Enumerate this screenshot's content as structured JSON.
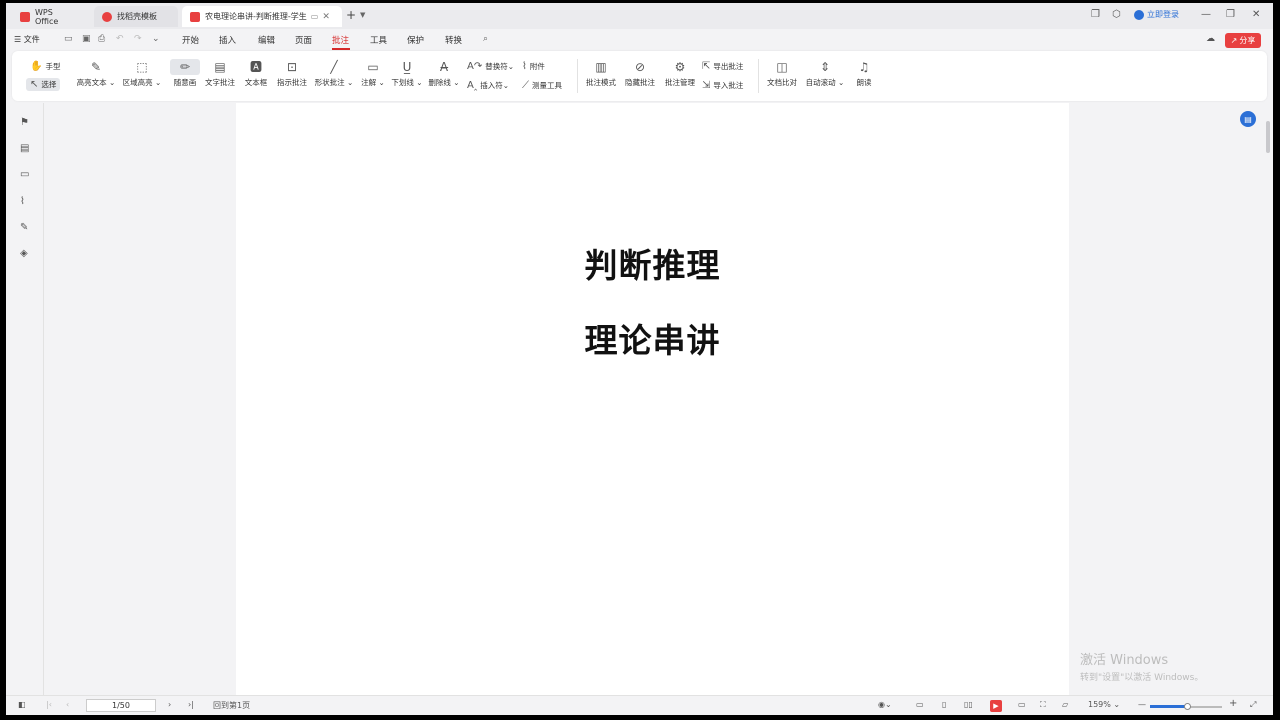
{
  "tabs": {
    "wps": "WPS Office",
    "template": "找稻壳模板",
    "document": "农电理论串讲-判断推理-学生"
  },
  "account": {
    "login": "立即登录"
  },
  "menu": {
    "file": "文件",
    "items": [
      "开始",
      "插入",
      "编辑",
      "页面",
      "批注",
      "工具",
      "保护",
      "转换"
    ],
    "active": "批注",
    "share": "分享"
  },
  "ribbon": {
    "hand": "手型",
    "select": "选择",
    "highlight_text": "高亮文本",
    "area_highlight": "区域高亮",
    "freehand": "随意画",
    "text_comment": "文字批注",
    "textbox": "文本框",
    "pointer_comment": "指示批注",
    "shape_comment": "形状批注",
    "annotate": "注解",
    "underline": "下划线",
    "strikethrough": "删除线",
    "replace_char": "替换符",
    "insert_char": "插入符",
    "attachment": "附件",
    "measure_tool": "测量工具",
    "comment_mode": "批注模式",
    "hide_comments": "隐藏批注",
    "comment_manage": "批注管理",
    "export_comments": "导出批注",
    "import_comments": "导入批注",
    "doc_compare": "文档比对",
    "auto_scroll": "自动滚动",
    "read_aloud": "朗读"
  },
  "document": {
    "line1": "判断推理",
    "line2": "理论串讲"
  },
  "watermark": {
    "line1": "激活 Windows",
    "line2": "转到\"设置\"以激活 Windows。"
  },
  "status": {
    "page": "1/50",
    "back_to_page": "回到第1页",
    "zoom": "159%"
  }
}
